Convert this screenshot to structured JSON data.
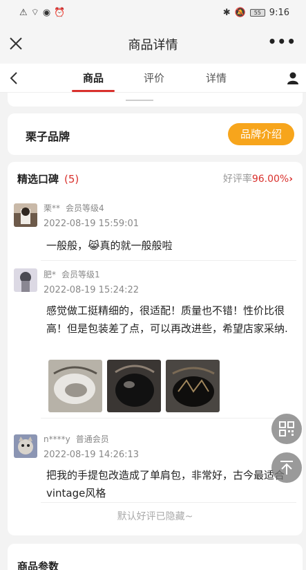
{
  "status_bar": {
    "time": "9:16",
    "battery": "55"
  },
  "nav": {
    "title": "商品详情",
    "more": "•••"
  },
  "tabs": [
    {
      "label": "商品",
      "active": true
    },
    {
      "label": "评价",
      "active": false
    },
    {
      "label": "详情",
      "active": false
    }
  ],
  "brand": {
    "name": "栗子品牌",
    "button": "品牌介绍"
  },
  "reviews_section": {
    "title": "精选口碑",
    "count": "(5)",
    "rate_label": "好评率",
    "rate_value": "96.00%",
    "rate_arrow": "›",
    "hidden_note": "默认好评已隐藏~",
    "items": [
      {
        "user": "栗**",
        "level": "会员等级4",
        "date": "2022-08-19 15:59:01",
        "text": "一般般，😹真的就一般般啦"
      },
      {
        "user": "肥*",
        "level": "会员等级1",
        "date": "2022-08-19 15:24:22",
        "text": "感觉做工挺精细的，很适配！质量也不错！性价比很高！但是包装差了点，可以再改进些，希望店家采纳."
      },
      {
        "user": "n****y",
        "level": "普通会员",
        "date": "2022-08-19 14:26:13",
        "text": "把我的手提包改造成了单肩包，非常好，古今最适合vintage风格"
      }
    ]
  },
  "params": {
    "title": "商品参数"
  },
  "colors": {
    "accent": "#d9302c",
    "brand_button": "#f7a51c"
  },
  "icons": [
    "close-icon",
    "more-icon",
    "back-icon",
    "user-icon",
    "qrcode-icon",
    "back-to-top-icon"
  ]
}
